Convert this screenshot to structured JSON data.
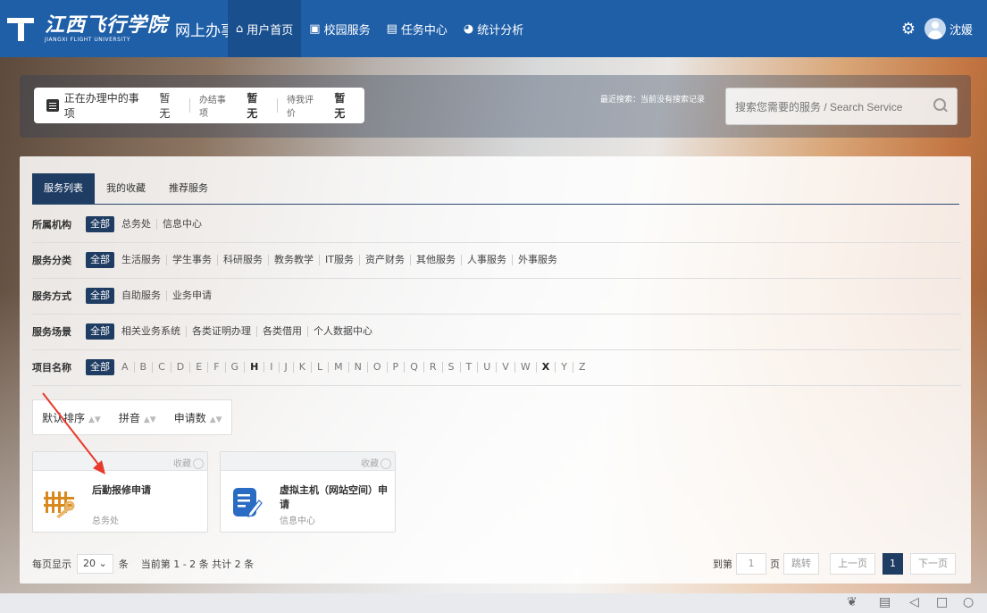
{
  "header": {
    "school_name_cn": "江西飞行学院",
    "school_name_en": "JIANGXI FLIGHT UNIVERSITY",
    "portal_title": "网上办事大厅",
    "nav": [
      {
        "label": "用户首页",
        "icon": "home-icon",
        "active": true
      },
      {
        "label": "校园服务",
        "icon": "briefcase-icon",
        "active": false
      },
      {
        "label": "任务中心",
        "icon": "task-icon",
        "active": false
      },
      {
        "label": "统计分析",
        "icon": "chart-icon",
        "active": false
      }
    ],
    "user_name": "沈媛"
  },
  "status": {
    "in_progress_label": "正在办理中的事项",
    "in_progress_value": "暂无",
    "done_label": "办结事项",
    "done_value": "暂无",
    "to_review_label": "待我评价",
    "to_review_value": "暂无"
  },
  "recent_search": "最近搜索：当前没有搜索记录",
  "search": {
    "placeholder": "搜索您需要的服务 / Search Service"
  },
  "tabs": [
    "服务列表",
    "我的收藏",
    "推荐服务"
  ],
  "filters": [
    {
      "label": "所属机构",
      "options": [
        "全部",
        "总务处",
        "信息中心"
      ]
    },
    {
      "label": "服务分类",
      "options": [
        "全部",
        "生活服务",
        "学生事务",
        "科研服务",
        "教务教学",
        "IT服务",
        "资产财务",
        "其他服务",
        "人事服务",
        "外事服务"
      ]
    },
    {
      "label": "服务方式",
      "options": [
        "全部",
        "自助服务",
        "业务申请"
      ]
    },
    {
      "label": "服务场景",
      "options": [
        "全部",
        "相关业务系统",
        "各类证明办理",
        "各类借用",
        "个人数据中心"
      ]
    },
    {
      "label": "项目名称",
      "options": [
        "全部",
        "A",
        "B",
        "C",
        "D",
        "E",
        "F",
        "G",
        "H",
        "I",
        "J",
        "K",
        "L",
        "M",
        "N",
        "O",
        "P",
        "Q",
        "R",
        "S",
        "T",
        "U",
        "V",
        "W",
        "X",
        "Y",
        "Z"
      ],
      "bold_letters": [
        "H",
        "X"
      ]
    }
  ],
  "sort": [
    "默认排序",
    "拼音",
    "申请数"
  ],
  "cards": [
    {
      "title": "后勤报修申请",
      "dept": "总务处",
      "fav": "收藏",
      "icon": "fence-repair-icon"
    },
    {
      "title": "虚拟主机（网站空间）申请",
      "dept": "信息中心",
      "fav": "收藏",
      "icon": "document-edit-icon"
    }
  ],
  "pager": {
    "per_page_label": "每页显示",
    "per_page_value": "20",
    "per_page_unit": "条",
    "summary": "当前第 1 - 2 条 共计 2 条",
    "goto_label": "到第",
    "goto_value": "1",
    "page_unit": "页",
    "jump": "跳转",
    "prev": "上一页",
    "current": "1",
    "next": "下一页"
  },
  "colors": {
    "nav": "#1f5fa8",
    "accent": "#1f3c62",
    "arrow": "#e8392b"
  }
}
